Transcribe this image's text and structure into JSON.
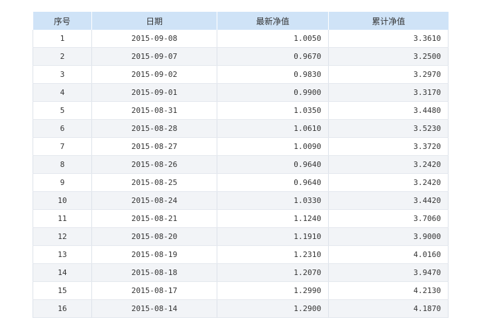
{
  "table": {
    "headers": [
      "序号",
      "日期",
      "最新净值",
      "累计净值"
    ],
    "rows": [
      {
        "index": "1",
        "date": "2015-09-08",
        "latest_nav": "1.0050",
        "cumulative_nav": "3.3610"
      },
      {
        "index": "2",
        "date": "2015-09-07",
        "latest_nav": "0.9670",
        "cumulative_nav": "3.2500"
      },
      {
        "index": "3",
        "date": "2015-09-02",
        "latest_nav": "0.9830",
        "cumulative_nav": "3.2970"
      },
      {
        "index": "4",
        "date": "2015-09-01",
        "latest_nav": "0.9900",
        "cumulative_nav": "3.3170"
      },
      {
        "index": "5",
        "date": "2015-08-31",
        "latest_nav": "1.0350",
        "cumulative_nav": "3.4480"
      },
      {
        "index": "6",
        "date": "2015-08-28",
        "latest_nav": "1.0610",
        "cumulative_nav": "3.5230"
      },
      {
        "index": "7",
        "date": "2015-08-27",
        "latest_nav": "1.0090",
        "cumulative_nav": "3.3720"
      },
      {
        "index": "8",
        "date": "2015-08-26",
        "latest_nav": "0.9640",
        "cumulative_nav": "3.2420"
      },
      {
        "index": "9",
        "date": "2015-08-25",
        "latest_nav": "0.9640",
        "cumulative_nav": "3.2420"
      },
      {
        "index": "10",
        "date": "2015-08-24",
        "latest_nav": "1.0330",
        "cumulative_nav": "3.4420"
      },
      {
        "index": "11",
        "date": "2015-08-21",
        "latest_nav": "1.1240",
        "cumulative_nav": "3.7060"
      },
      {
        "index": "12",
        "date": "2015-08-20",
        "latest_nav": "1.1910",
        "cumulative_nav": "3.9000"
      },
      {
        "index": "13",
        "date": "2015-08-19",
        "latest_nav": "1.2310",
        "cumulative_nav": "4.0160"
      },
      {
        "index": "14",
        "date": "2015-08-18",
        "latest_nav": "1.2070",
        "cumulative_nav": "3.9470"
      },
      {
        "index": "15",
        "date": "2015-08-17",
        "latest_nav": "1.2990",
        "cumulative_nav": "4.2130"
      },
      {
        "index": "16",
        "date": "2015-08-14",
        "latest_nav": "1.2900",
        "cumulative_nav": "4.1870"
      }
    ]
  },
  "colors": {
    "header_bg": "#cfe3f7",
    "row_alt_bg": "#f2f4f7",
    "text": "#333333"
  }
}
